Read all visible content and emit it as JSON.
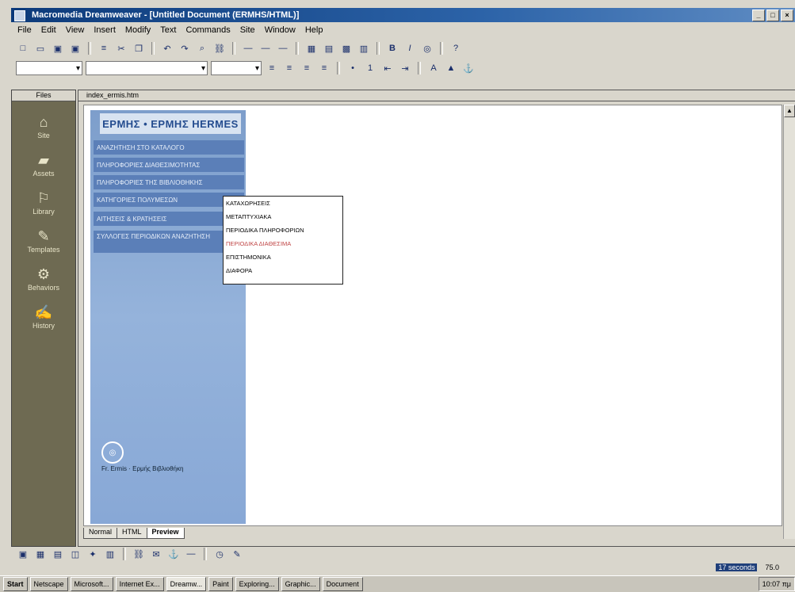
{
  "window": {
    "title": "Macromedia Dreamweaver - [Untitled Document (ERMHS/HTML)]"
  },
  "menu": [
    "File",
    "Edit",
    "View",
    "Insert",
    "Modify",
    "Text",
    "Commands",
    "Site",
    "Window",
    "Help"
  ],
  "left_panel": {
    "title": "Files",
    "items": [
      {
        "label": "Site",
        "icon": "site-icon"
      },
      {
        "label": "Assets",
        "icon": "assets-icon"
      },
      {
        "label": "Library",
        "icon": "library-icon"
      },
      {
        "label": "Templates",
        "icon": "templates-icon"
      },
      {
        "label": "Behaviors",
        "icon": "behaviors-icon"
      },
      {
        "label": "History",
        "icon": "history-icon"
      }
    ]
  },
  "document": {
    "title": "index_ermis.htm",
    "logo": "ΕΡΜΗΣ • ΕΡΜΗΣ HERMES",
    "nav_items": [
      "ΑΝΑΖΗΤΗΣΗ ΣΤΟ ΚΑΤΑΛΟΓΟ",
      "ΠΛΗΡΟΦΟΡΙΕΣ ΔΙΑΘΕΣΙΜΟΤΗΤΑΣ",
      "ΠΛΗΡΟΦΟΡΙΕΣ ΤΗΣ ΒΙΒΛΙΟΘΗΚΗΣ",
      "ΚΑΤΗΓΟΡΙΕΣ ΠΟΛΥΜΕΣΩΝ",
      "ΑΙΤΗΣΕΙΣ & ΚΡΑΤΗΣΕΙΣ",
      "ΣΥΛΛΟΓΕΣ ΠΕΡΙΟΔΙΚΩΝ ΑΝΑΖΗΤΗΣΗ"
    ],
    "popup_items": [
      "ΚΑΤΑΧΩΡΗΣΕΙΣ",
      "ΜΕΤΑΠΤΥΧΙΑΚΑ",
      "ΠΕΡΙΟΔΙΚΑ ΠΛΗΡΟΦΟΡΙΩΝ",
      "ΠΕΡΙΟΔΙΚΑ ΔΙΑΘΕΣΙΜΑ",
      "ΕΠΙΣΤΗΜΟΝΙΚΑ",
      "ΔΙΑΦΟΡΑ"
    ],
    "popup_selected_index": 3,
    "footer_text": "Fr. Ermis · Ερμής Βιβλιοθήκη"
  },
  "view_tabs": [
    "Normal",
    "HTML",
    "Preview"
  ],
  "status": {
    "size": "17 seconds",
    "zoom": "75.0"
  },
  "taskbar": {
    "start": "Start",
    "buttons": [
      "Netscape",
      "Microsoft...",
      "Internet Ex...",
      "Dreamw...",
      "Paint",
      "Exploring...",
      "Graphic...",
      "Document"
    ],
    "clock": "10:07 πμ"
  }
}
